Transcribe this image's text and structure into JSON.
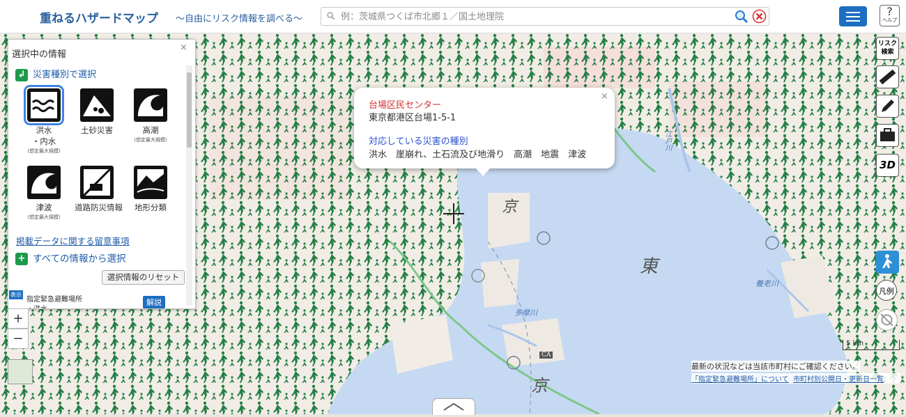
{
  "header": {
    "title": "重ねるハザードマップ",
    "subtitle": "～自由にリスク情報を調べる～",
    "search_placeholder": "例：茨城県つくば市北郷１／国土地理院",
    "help_label": "ヘルプ",
    "help_glyph": "?"
  },
  "panel": {
    "title": "選択中の情報",
    "close": "×",
    "section_hazard": "災害種別で選択",
    "hazards": [
      {
        "label": "洪水",
        "label2": "・内水",
        "note": "(想定最大規模)",
        "icon": "flood-icon"
      },
      {
        "label": "土砂災害",
        "label2": "",
        "note": "",
        "icon": "landslide-icon"
      },
      {
        "label": "高潮",
        "label2": "",
        "note": "(想定最大規模)",
        "icon": "storm-surge-icon"
      },
      {
        "label": "津波",
        "label2": "",
        "note": "(想定最大規模)",
        "icon": "tsunami-icon"
      },
      {
        "label": "道路防災情報",
        "label2": "",
        "note": "",
        "icon": "road-disaster-icon"
      },
      {
        "label": "地形分類",
        "label2": "",
        "note": "",
        "icon": "terrain-icon"
      }
    ],
    "note_link": "掲載データに関する留意事項",
    "section_all": "すべての情報から選択",
    "reset_button": "選択情報のリセット",
    "layer_tag": "表示",
    "layer_name": "指定緊急避難場所",
    "layer_sub": "・洪水",
    "layer_explain": "解説"
  },
  "popup": {
    "close": "×",
    "name": "台場区民センター",
    "address": "東京都港区台場1-5-1",
    "types_heading": "対応している災害の種別",
    "types": "洪水　崖崩れ、土石流及び地滑り　高潮　地震　津波"
  },
  "map": {
    "zoom_in": "+",
    "zoom_out": "−",
    "tools": {
      "risk_search": "リスク検索",
      "three_d": "3D",
      "legend": "凡例"
    },
    "scale_label": "5 km",
    "attribution_text": "最新の状況などは当該市町村にご確認ください。",
    "attribution_link1": "「指定緊急避難場所」について",
    "attribution_link2": "市町村別公開日・更新日一覧",
    "labels": [
      "京",
      "東",
      "京",
      "江戸川",
      "養老川",
      "多摩川",
      "CA"
    ]
  },
  "colors": {
    "brand_blue": "#1d6ec1",
    "title_blue": "#2a5f9e",
    "accent_green": "#1e9a4c",
    "shelter_green": "#1b7a3e",
    "sea": "#c6d9f2",
    "popup_red": "#d63030",
    "popup_blue": "#2a4fd0"
  }
}
